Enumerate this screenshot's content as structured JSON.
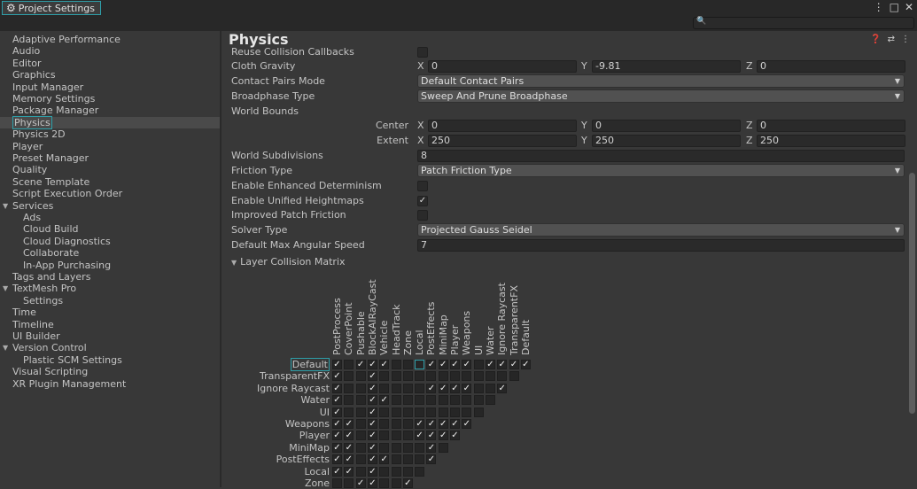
{
  "window": {
    "title": "Project Settings",
    "controls": [
      "⋮",
      "□",
      "✕"
    ]
  },
  "search": {
    "placeholder": ""
  },
  "sidebar": {
    "items": [
      {
        "label": "Adaptive Performance",
        "indent": 0
      },
      {
        "label": "Audio",
        "indent": 0
      },
      {
        "label": "Editor",
        "indent": 0
      },
      {
        "label": "Graphics",
        "indent": 0
      },
      {
        "label": "Input Manager",
        "indent": 0
      },
      {
        "label": "Memory Settings",
        "indent": 0
      },
      {
        "label": "Package Manager",
        "indent": 0
      },
      {
        "label": "Physics",
        "indent": 0,
        "selected": true
      },
      {
        "label": "Physics 2D",
        "indent": 0
      },
      {
        "label": "Player",
        "indent": 0
      },
      {
        "label": "Preset Manager",
        "indent": 0
      },
      {
        "label": "Quality",
        "indent": 0
      },
      {
        "label": "Scene Template",
        "indent": 0
      },
      {
        "label": "Script Execution Order",
        "indent": 0
      },
      {
        "label": "Services",
        "indent": 0,
        "expanded": true
      },
      {
        "label": "Ads",
        "indent": 1
      },
      {
        "label": "Cloud Build",
        "indent": 1
      },
      {
        "label": "Cloud Diagnostics",
        "indent": 1
      },
      {
        "label": "Collaborate",
        "indent": 1
      },
      {
        "label": "In-App Purchasing",
        "indent": 1
      },
      {
        "label": "Tags and Layers",
        "indent": 0
      },
      {
        "label": "TextMesh Pro",
        "indent": 0,
        "expanded": true
      },
      {
        "label": "Settings",
        "indent": 1
      },
      {
        "label": "Time",
        "indent": 0
      },
      {
        "label": "Timeline",
        "indent": 0
      },
      {
        "label": "UI Builder",
        "indent": 0
      },
      {
        "label": "Version Control",
        "indent": 0,
        "expanded": true
      },
      {
        "label": "Plastic SCM Settings",
        "indent": 1
      },
      {
        "label": "Visual Scripting",
        "indent": 0
      },
      {
        "label": "XR Plugin Management",
        "indent": 0
      }
    ]
  },
  "main": {
    "title": "Physics",
    "header_icons": [
      "help-icon",
      "settings-sliders-icon",
      "more-icon"
    ],
    "reuse_collision_callbacks": {
      "label": "Reuse Collision Callbacks",
      "checked": false
    },
    "cloth_gravity": {
      "label": "Cloth Gravity",
      "x": "0",
      "y": "-9.81",
      "z": "0"
    },
    "contact_pairs_mode": {
      "label": "Contact Pairs Mode",
      "value": "Default Contact Pairs"
    },
    "broadphase_type": {
      "label": "Broadphase Type",
      "value": "Sweep And Prune Broadphase"
    },
    "world_bounds": {
      "label": "World Bounds",
      "center_label": "Center",
      "center": {
        "x": "0",
        "y": "0",
        "z": "0"
      },
      "extent_label": "Extent",
      "extent": {
        "x": "250",
        "y": "250",
        "z": "250"
      }
    },
    "axis_labels": {
      "x": "X",
      "y": "Y",
      "z": "Z"
    },
    "world_subdivisions": {
      "label": "World Subdivisions",
      "value": "8"
    },
    "friction_type": {
      "label": "Friction Type",
      "value": "Patch Friction Type"
    },
    "enhanced_determinism": {
      "label": "Enable Enhanced Determinism",
      "checked": false
    },
    "unified_heightmaps": {
      "label": "Enable Unified Heightmaps",
      "checked": true
    },
    "improved_patch_friction": {
      "label": "Improved Patch Friction",
      "checked": false
    },
    "solver_type": {
      "label": "Solver Type",
      "value": "Projected Gauss Seidel"
    },
    "max_angular_speed": {
      "label": "Default Max Angular Speed",
      "value": "7"
    },
    "layer_collision_matrix": {
      "label": "Layer Collision Matrix",
      "columns": [
        "PostProcess",
        "CoverPoint",
        "Pushable",
        "BlockAIRayCast",
        "Vehicle",
        "HeadTrack",
        "Zone",
        "Local",
        "PostEffects",
        "MiniMap",
        "Player",
        "Weapons",
        "UI",
        "Water",
        "Ignore Raycast",
        "TransparentFX",
        "Default"
      ],
      "rows": [
        {
          "label": "Default",
          "checks": [
            1,
            0,
            1,
            1,
            1,
            0,
            0,
            0,
            1,
            1,
            1,
            1,
            0,
            1,
            1,
            1,
            1
          ]
        },
        {
          "label": "TransparentFX",
          "checks": [
            1,
            0,
            0,
            1,
            0,
            0,
            0,
            0,
            0,
            0,
            0,
            0,
            0,
            0,
            0,
            0
          ]
        },
        {
          "label": "Ignore Raycast",
          "checks": [
            1,
            0,
            0,
            1,
            0,
            0,
            0,
            0,
            1,
            1,
            1,
            1,
            0,
            0,
            1
          ]
        },
        {
          "label": "Water",
          "checks": [
            1,
            0,
            0,
            1,
            1,
            0,
            0,
            0,
            0,
            0,
            0,
            0,
            0,
            0
          ]
        },
        {
          "label": "UI",
          "checks": [
            1,
            0,
            0,
            1,
            0,
            0,
            0,
            0,
            0,
            0,
            0,
            0,
            0
          ]
        },
        {
          "label": "Weapons",
          "checks": [
            1,
            1,
            0,
            1,
            0,
            0,
            0,
            1,
            1,
            1,
            1,
            1
          ]
        },
        {
          "label": "Player",
          "checks": [
            1,
            1,
            0,
            1,
            0,
            0,
            0,
            1,
            1,
            1,
            1
          ]
        },
        {
          "label": "MiniMap",
          "checks": [
            1,
            1,
            0,
            1,
            0,
            0,
            0,
            0,
            1,
            0
          ]
        },
        {
          "label": "PostEffects",
          "checks": [
            1,
            1,
            0,
            1,
            1,
            0,
            0,
            0,
            1
          ]
        },
        {
          "label": "Local",
          "checks": [
            1,
            1,
            0,
            1,
            0,
            0,
            0,
            0
          ]
        },
        {
          "label": "Zone",
          "checks": [
            0,
            0,
            1,
            1,
            0,
            0,
            1
          ]
        }
      ],
      "selected_row": "Default",
      "selected_col": "Local"
    }
  },
  "colors": {
    "accent": "#2e9ea8",
    "background": "#383838",
    "field": "#2a2a2a"
  }
}
